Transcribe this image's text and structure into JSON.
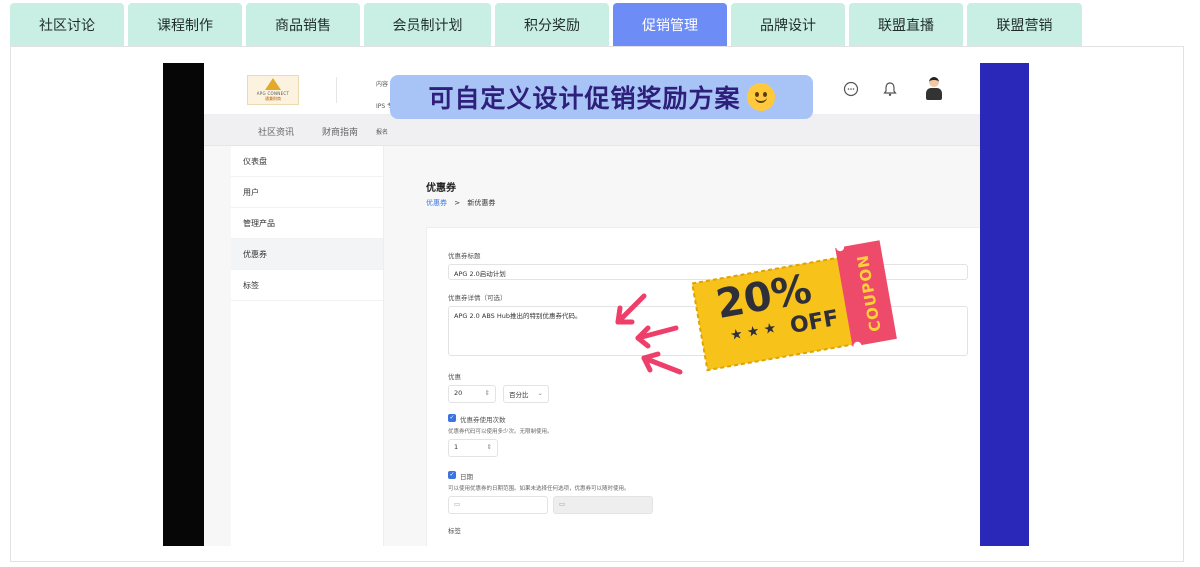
{
  "tabs": [
    {
      "label": "社区讨论",
      "active": false
    },
    {
      "label": "课程制作",
      "active": false
    },
    {
      "label": "商品销售",
      "active": false
    },
    {
      "label": "会员制计划",
      "active": false
    },
    {
      "label": "积分奖励",
      "active": false
    },
    {
      "label": "促销管理",
      "active": true
    },
    {
      "label": "品牌设计",
      "active": false
    },
    {
      "label": "联盟直播",
      "active": false
    },
    {
      "label": "联盟营销",
      "active": false
    }
  ],
  "colors": {
    "tab_bg": "#c9eee4",
    "tab_active_bg": "#6e8cf6",
    "banner_bg": "#a8c4f7",
    "banner_text": "#2d1f7a",
    "coupon_yellow": "#f7c21a",
    "coupon_pink": "#ee4b6b",
    "right_bar": "#2a28b8"
  },
  "video": {
    "banner_text": "可自定义设计促销奖励方案",
    "banner_emoji": "smile-emoji",
    "logo": {
      "line1": "APG CONNECT",
      "line2": "通兼财商"
    },
    "header_small": [
      "内容",
      "IPS 专",
      "报名"
    ],
    "nav": [
      "社区资讯",
      "财商指南"
    ],
    "sidebar": [
      "仪表盘",
      "用户",
      "管理产品",
      "优惠券",
      "标签"
    ],
    "sidebar_selected": "优惠券",
    "page_title": "优惠券",
    "breadcrumb": {
      "link": "优惠券",
      "sep": ">",
      "current": "新优惠券"
    },
    "form": {
      "title_label": "优惠券标题",
      "title_value": "APG 2.0启动计划",
      "detail_label": "优惠券详情（可选）",
      "detail_value": "APG 2.0 ABS Hub推出的特别优惠券代码。",
      "discount_label": "优惠",
      "discount_value": "20",
      "discount_unit": "百分比",
      "usage_label": "优惠券使用次数",
      "usage_note": "优惠券代码可以使用多少次。无限制使用。",
      "usage_value": "1",
      "date_label": "日期",
      "date_note": "可以使用优惠券的日期范围。如果未选择任何选项，优惠券可以随时使用。",
      "tags_label": "标签"
    },
    "coupon": {
      "percent": "20%",
      "off": "OFF",
      "side": "COUPON"
    }
  }
}
